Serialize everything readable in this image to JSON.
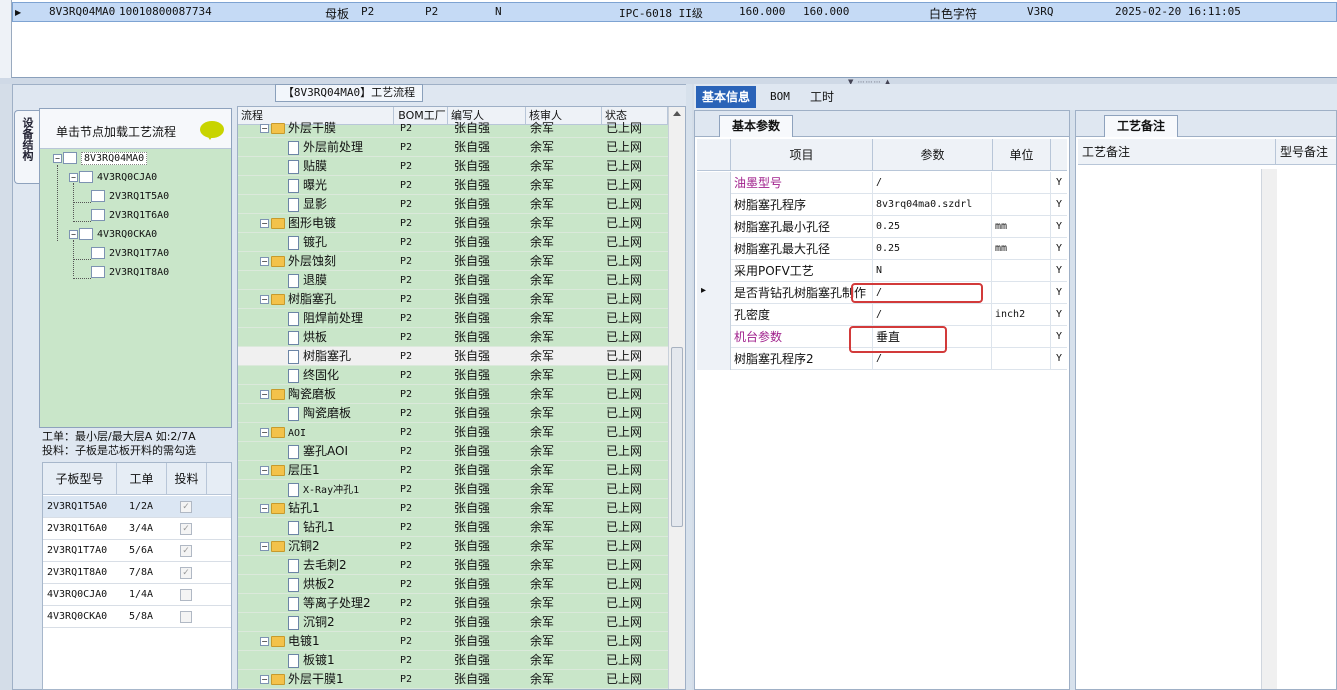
{
  "top_row": {
    "code": "8V3RQ04MA0",
    "order": "10010800087734",
    "type": "母板",
    "p1": "P2",
    "p2": "P2",
    "flag": "N",
    "grade": "IPC-6018 II级",
    "v1": "160.000",
    "v2": "160.000",
    "marking": "白色字符",
    "series": "V3RQ",
    "time": "2025-02-20 16:11:05"
  },
  "flow_title": "【8V3RQ04MA0】工艺流程",
  "device_tab": "设备结构",
  "tree": {
    "header": "单击节点加载工艺流程",
    "nodes": [
      "8V3RQ04MA0",
      "4V3RQ0CJA0",
      "2V3RQ1T5A0",
      "2V3RQ1T6A0",
      "4V3RQ0CKA0",
      "2V3RQ1T7A0",
      "2V3RQ1T8A0"
    ]
  },
  "note": {
    "line1": "工单：最小层/最大层A 如:2/7A",
    "line2": "投料：子板是芯板开料的需勾选"
  },
  "sub_table": {
    "headers": [
      "子板型号",
      "工单",
      "投料"
    ],
    "rows": [
      {
        "model": "2V3RQ1T5A0",
        "order": "1/2A",
        "checked": true
      },
      {
        "model": "2V3RQ1T6A0",
        "order": "3/4A",
        "checked": true
      },
      {
        "model": "2V3RQ1T7A0",
        "order": "5/6A",
        "checked": true
      },
      {
        "model": "2V3RQ1T8A0",
        "order": "7/8A",
        "checked": true
      },
      {
        "model": "4V3RQ0CJA0",
        "order": "1/4A",
        "checked": false
      },
      {
        "model": "4V3RQ0CKA0",
        "order": "5/8A",
        "checked": false
      }
    ]
  },
  "process": {
    "headers": [
      "流程",
      "BOM工厂",
      "编写人",
      "核审人",
      "状态"
    ],
    "rows": [
      {
        "name": "外层干膜",
        "level": 0,
        "factory": "P2",
        "writer": "张自强",
        "reviewer": "余军",
        "status": "已上网"
      },
      {
        "name": "外层前处理",
        "level": 1,
        "factory": "P2",
        "writer": "张自强",
        "reviewer": "余军",
        "status": "已上网"
      },
      {
        "name": "贴膜",
        "level": 1,
        "factory": "P2",
        "writer": "张自强",
        "reviewer": "余军",
        "status": "已上网"
      },
      {
        "name": "曝光",
        "level": 1,
        "factory": "P2",
        "writer": "张自强",
        "reviewer": "余军",
        "status": "已上网"
      },
      {
        "name": "显影",
        "level": 1,
        "factory": "P2",
        "writer": "张自强",
        "reviewer": "余军",
        "status": "已上网"
      },
      {
        "name": "图形电镀",
        "level": 0,
        "factory": "P2",
        "writer": "张自强",
        "reviewer": "余军",
        "status": "已上网"
      },
      {
        "name": "镀孔",
        "level": 1,
        "factory": "P2",
        "writer": "张自强",
        "reviewer": "余军",
        "status": "已上网"
      },
      {
        "name": "外层蚀刻",
        "level": 0,
        "factory": "P2",
        "writer": "张自强",
        "reviewer": "余军",
        "status": "已上网"
      },
      {
        "name": "退膜",
        "level": 1,
        "factory": "P2",
        "writer": "张自强",
        "reviewer": "余军",
        "status": "已上网"
      },
      {
        "name": "树脂塞孔",
        "level": 0,
        "factory": "P2",
        "writer": "张自强",
        "reviewer": "余军",
        "status": "已上网"
      },
      {
        "name": "阻焊前处理",
        "level": 1,
        "factory": "P2",
        "writer": "张自强",
        "reviewer": "余军",
        "status": "已上网"
      },
      {
        "name": "烘板",
        "level": 1,
        "factory": "P2",
        "writer": "张自强",
        "reviewer": "余军",
        "status": "已上网"
      },
      {
        "name": "树脂塞孔",
        "level": 1,
        "factory": "P2",
        "writer": "张自强",
        "reviewer": "余军",
        "status": "已上网",
        "selected": true
      },
      {
        "name": "终固化",
        "level": 1,
        "factory": "P2",
        "writer": "张自强",
        "reviewer": "余军",
        "status": "已上网"
      },
      {
        "name": "陶瓷磨板",
        "level": 0,
        "factory": "P2",
        "writer": "张自强",
        "reviewer": "余军",
        "status": "已上网"
      },
      {
        "name": "陶瓷磨板",
        "level": 1,
        "factory": "P2",
        "writer": "张自强",
        "reviewer": "余军",
        "status": "已上网"
      },
      {
        "name": "AOI",
        "level": 0,
        "factory": "P2",
        "writer": "张自强",
        "reviewer": "余军",
        "status": "已上网"
      },
      {
        "name": "塞孔AOI",
        "level": 1,
        "factory": "P2",
        "writer": "张自强",
        "reviewer": "余军",
        "status": "已上网"
      },
      {
        "name": "层压1",
        "level": 0,
        "factory": "P2",
        "writer": "张自强",
        "reviewer": "余军",
        "status": "已上网"
      },
      {
        "name": "X-Ray冲孔1",
        "level": 1,
        "factory": "P2",
        "writer": "张自强",
        "reviewer": "余军",
        "status": "已上网"
      },
      {
        "name": "钻孔1",
        "level": 0,
        "factory": "P2",
        "writer": "张自强",
        "reviewer": "余军",
        "status": "已上网"
      },
      {
        "name": "钻孔1",
        "level": 1,
        "factory": "P2",
        "writer": "张自强",
        "reviewer": "余军",
        "status": "已上网"
      },
      {
        "name": "沉铜2",
        "level": 0,
        "factory": "P2",
        "writer": "张自强",
        "reviewer": "余军",
        "status": "已上网"
      },
      {
        "name": "去毛刺2",
        "level": 1,
        "factory": "P2",
        "writer": "张自强",
        "reviewer": "余军",
        "status": "已上网"
      },
      {
        "name": "烘板2",
        "level": 1,
        "factory": "P2",
        "writer": "张自强",
        "reviewer": "余军",
        "status": "已上网"
      },
      {
        "name": "等离子处理2",
        "level": 1,
        "factory": "P2",
        "writer": "张自强",
        "reviewer": "余军",
        "status": "已上网"
      },
      {
        "name": "沉铜2",
        "level": 1,
        "factory": "P2",
        "writer": "张自强",
        "reviewer": "余军",
        "status": "已上网"
      },
      {
        "name": "电镀1",
        "level": 0,
        "factory": "P2",
        "writer": "张自强",
        "reviewer": "余军",
        "status": "已上网"
      },
      {
        "name": "板镀1",
        "level": 1,
        "factory": "P2",
        "writer": "张自强",
        "reviewer": "余军",
        "status": "已上网"
      },
      {
        "name": "外层干膜1",
        "level": 0,
        "factory": "P2",
        "writer": "张自强",
        "reviewer": "余军",
        "status": "已上网"
      }
    ]
  },
  "right_tabs": [
    "基本信息",
    "BOM",
    "工时"
  ],
  "params": {
    "tab": "基本参数",
    "headers": [
      "项目",
      "参数",
      "单位"
    ],
    "rows": [
      {
        "item": "油墨型号",
        "value": "/",
        "unit": "",
        "flag": "Y",
        "purple": true
      },
      {
        "item": "树脂塞孔程序",
        "value": "8v3rq04ma0.szdrl",
        "unit": "",
        "flag": "Y"
      },
      {
        "item": "树脂塞孔最小孔径",
        "value": "0.25",
        "unit": "mm",
        "flag": "Y"
      },
      {
        "item": "树脂塞孔最大孔径",
        "value": "0.25",
        "unit": "mm",
        "flag": "Y"
      },
      {
        "item": "采用POFV工艺",
        "value": "N",
        "unit": "",
        "flag": "Y"
      },
      {
        "item": "是否背钻孔树脂塞孔制作",
        "value": "/",
        "unit": "",
        "flag": "Y",
        "current": true
      },
      {
        "item": "孔密度",
        "value": "/",
        "unit": "inch2",
        "flag": "Y"
      },
      {
        "item": "机台参数",
        "value": "垂直",
        "unit": "",
        "flag": "Y",
        "purple": true
      },
      {
        "item": "树脂塞孔程序2",
        "value": "/",
        "unit": "",
        "flag": "Y"
      }
    ]
  },
  "notes": {
    "tab": "工艺备注",
    "headers": [
      "工艺备注",
      "型号备注"
    ]
  },
  "colors": {
    "tree_bg": "#c9e6c9",
    "accent": "#2a63b8",
    "highlight": "#d23a3a",
    "purple": "#a0208c"
  }
}
